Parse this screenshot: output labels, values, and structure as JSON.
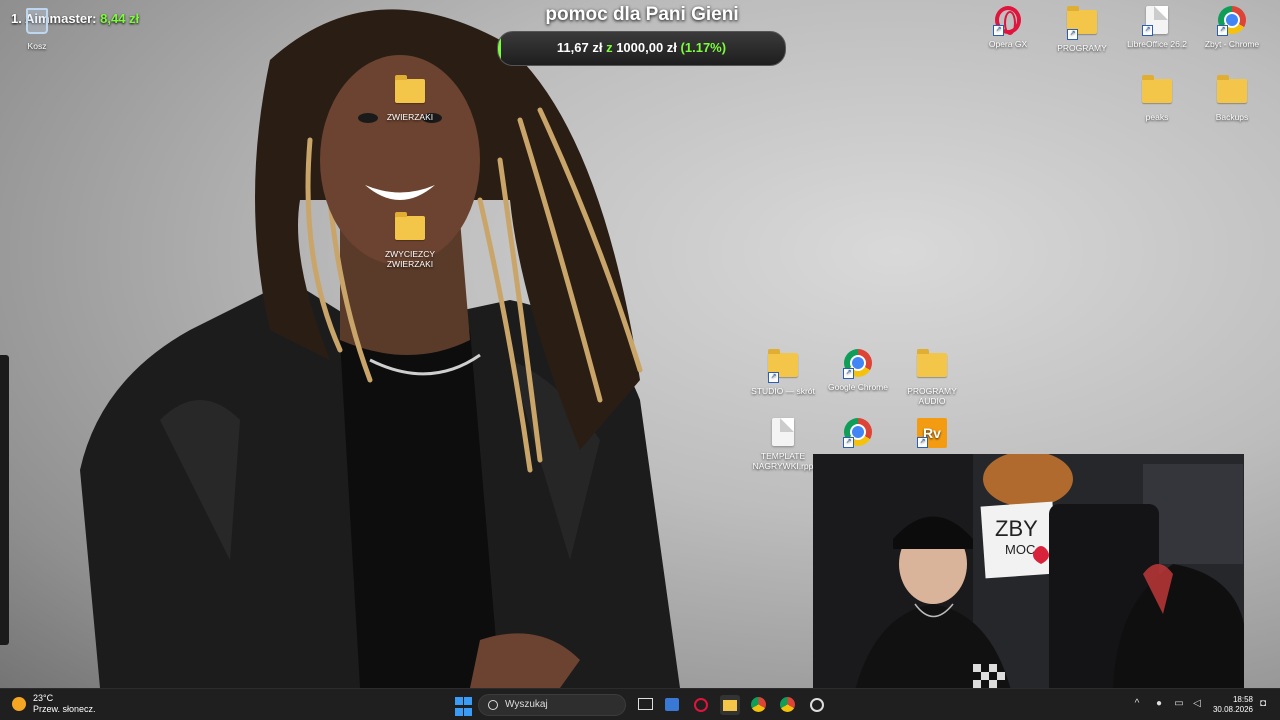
{
  "overlay": {
    "top_donor_label": "1. Aimmaster:",
    "top_donor_amount": "8,44 zł",
    "goal_title": "pomoc dla Pani Gieni",
    "goal_current": "11,67 zł",
    "goal_separator": "z",
    "goal_target": "1000,00 zł",
    "goal_percent": "(1.17%)",
    "goal_progress": 0.0117,
    "accent_color": "#7CFC3A"
  },
  "desktop_icons": {
    "recycle": "Kosz",
    "opera": "Opera GX",
    "programy": "PROGRAMY",
    "libreoffice": "LibreOffice 26.2",
    "zbyt_chrome": "Zbyt - Chrome",
    "peaks": "peaks",
    "backups": "Backups",
    "zwierzaki": "ZWIERZAKI",
    "zwyciezcy": "ZWYCIEZCY ZWIERZAKI",
    "studio": "STUDIO — skrót",
    "google_chrome": "Google Chrome",
    "programy_audio": "PROGRAMY AUDIO",
    "template": "TEMPLATE NAGRYWKI.rpp"
  },
  "webcam": {
    "sign_line1": "ZBY",
    "sign_line2": "MOC"
  },
  "taskbar": {
    "temperature": "23°C",
    "weather": "Przew. słonecz.",
    "search_placeholder": "Wyszukaj",
    "time": "18:58",
    "date": "30.08.2026"
  }
}
